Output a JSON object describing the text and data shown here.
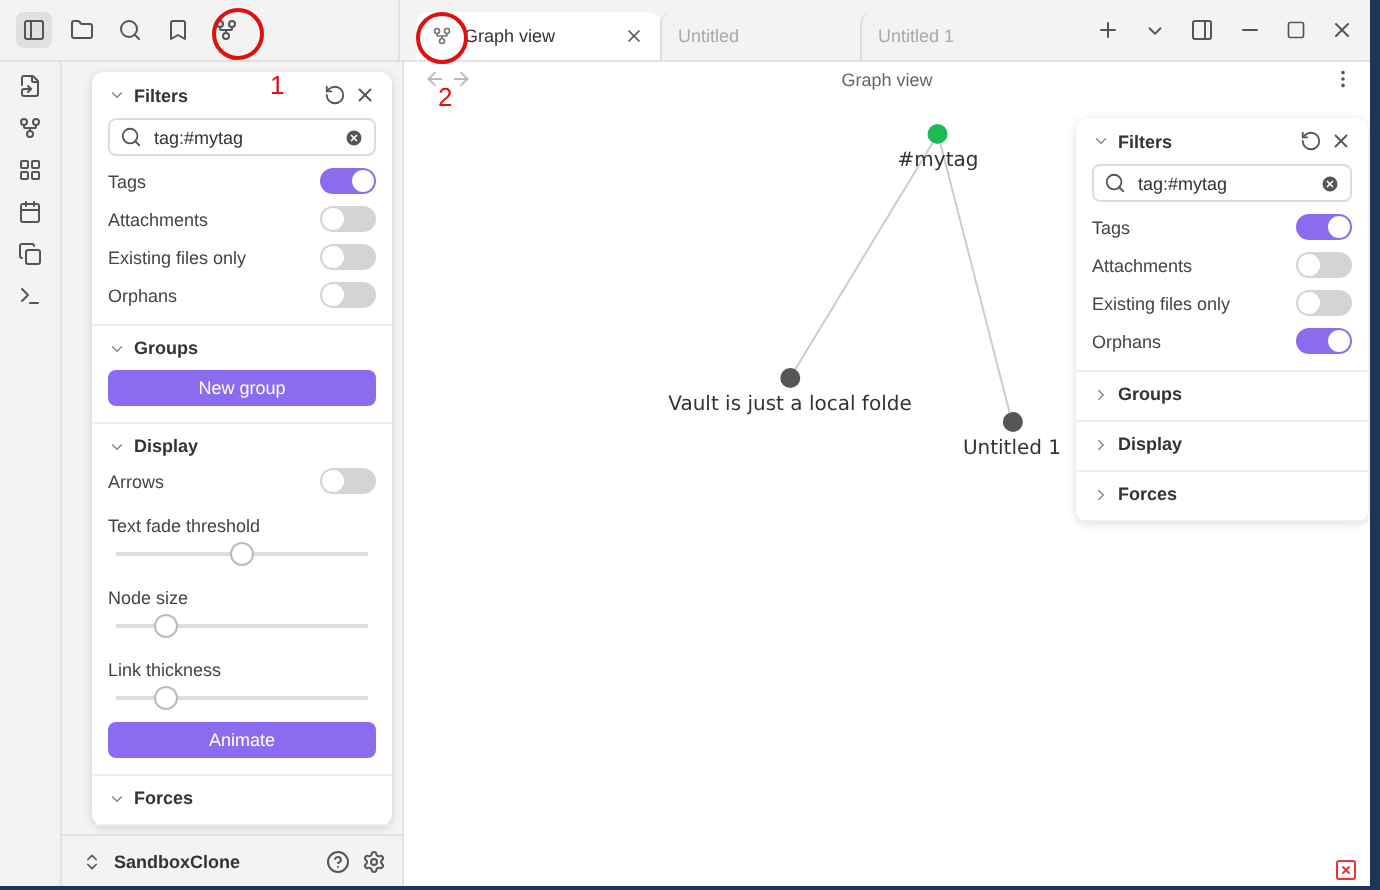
{
  "tabs": [
    {
      "label": "Graph view",
      "selected": true
    },
    {
      "label": "Untitled",
      "selected": false
    },
    {
      "label": "Untitled 1",
      "selected": false
    }
  ],
  "graph": {
    "title": "Graph view",
    "nodes": [
      {
        "label": "#mytag",
        "color": "#1db954"
      },
      {
        "label": "Vault is just a local folde",
        "color": "#555555"
      },
      {
        "label": "Untitled 1",
        "color": "#555555"
      }
    ]
  },
  "left_panel": {
    "sections": [
      {
        "title": "Filters",
        "expanded": true,
        "items": [
          {
            "kind": "search",
            "value": "tag:#mytag"
          },
          {
            "kind": "toggle",
            "label": "Tags",
            "on": true
          },
          {
            "kind": "toggle",
            "label": "Attachments",
            "on": false
          },
          {
            "kind": "toggle",
            "label": "Existing files only",
            "on": false
          },
          {
            "kind": "toggle",
            "label": "Orphans",
            "on": false
          }
        ]
      },
      {
        "title": "Groups",
        "expanded": true,
        "items": [
          {
            "kind": "button",
            "label": "New group"
          }
        ]
      },
      {
        "title": "Display",
        "expanded": true,
        "items": [
          {
            "kind": "toggle",
            "label": "Arrows",
            "on": false
          },
          {
            "kind": "slider",
            "label": "Text fade threshold",
            "level": 0.5
          },
          {
            "kind": "slider",
            "label": "Node size",
            "level": 0.2
          },
          {
            "kind": "slider",
            "label": "Link thickness",
            "level": 0.2
          },
          {
            "kind": "button",
            "label": "Animate"
          }
        ]
      },
      {
        "title": "Forces",
        "expanded": true
      }
    ]
  },
  "right_panel": {
    "sections": [
      {
        "title": "Filters",
        "expanded": true,
        "items": [
          {
            "kind": "search",
            "value": "tag:#mytag"
          },
          {
            "kind": "toggle",
            "label": "Tags",
            "on": true
          },
          {
            "kind": "toggle",
            "label": "Attachments",
            "on": false
          },
          {
            "kind": "toggle",
            "label": "Existing files only",
            "on": false
          },
          {
            "kind": "toggle",
            "label": "Orphans",
            "on": true
          }
        ]
      },
      {
        "title": "Groups",
        "expanded": false
      },
      {
        "title": "Display",
        "expanded": false
      },
      {
        "title": "Forces",
        "expanded": false
      }
    ]
  },
  "vault": {
    "name": "SandboxClone"
  },
  "annotations": [
    {
      "label": "1"
    },
    {
      "label": "2"
    }
  ]
}
